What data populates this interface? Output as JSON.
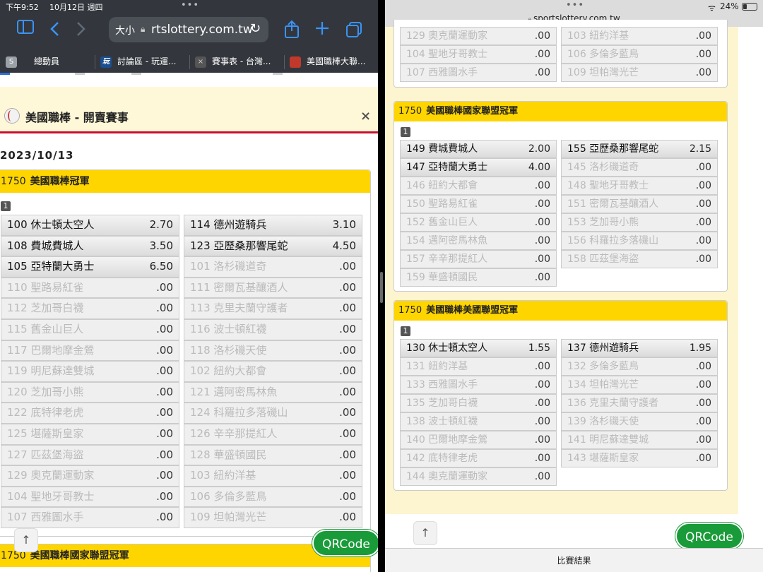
{
  "left_chrome": {
    "time": "下午9:52",
    "date": "10月12日 週四",
    "text_size": "大小",
    "url": "rtslottery.com.tw",
    "tabs": [
      {
        "label": "總動員",
        "icon": "S"
      },
      {
        "label": "討論區 - 玩運...",
        "icon": "玩"
      },
      {
        "label": "賽事表 - 台灣...",
        "icon": "×"
      },
      {
        "label": "美國職棒大聯...",
        "icon": ""
      }
    ]
  },
  "left_page": {
    "modal_title": "美國職棒 - 開賣賽事",
    "close": "×",
    "date": "2023/10/13",
    "game_id": "1750",
    "game_title": "美國職棒冠軍",
    "group_num": "1",
    "rows": [
      [
        {
          "t": "100 休士頓太空人",
          "o": "2.70",
          "on": true
        },
        {
          "t": "114 德州遊騎兵",
          "o": "3.10",
          "on": true
        }
      ],
      [
        {
          "t": "108 費城費城人",
          "o": "3.50",
          "on": true
        },
        {
          "t": "123 亞歷桑那響尾蛇",
          "o": "4.50",
          "on": true
        }
      ],
      [
        {
          "t": "105 亞特蘭大勇士",
          "o": "6.50",
          "on": true
        },
        {
          "t": "101 洛杉磯道奇",
          "o": ".00",
          "on": false
        }
      ],
      [
        {
          "t": "110 聖路易紅雀",
          "o": ".00",
          "on": false
        },
        {
          "t": "111 密爾瓦基釀酒人",
          "o": ".00",
          "on": false
        }
      ],
      [
        {
          "t": "112 芝加哥白襪",
          "o": ".00",
          "on": false
        },
        {
          "t": "113 克里夫蘭守護者",
          "o": ".00",
          "on": false
        }
      ],
      [
        {
          "t": "115 舊金山巨人",
          "o": ".00",
          "on": false
        },
        {
          "t": "116 波士頓紅襪",
          "o": ".00",
          "on": false
        }
      ],
      [
        {
          "t": "117 巴爾地摩金鶯",
          "o": ".00",
          "on": false
        },
        {
          "t": "118 洛杉磯天使",
          "o": ".00",
          "on": false
        }
      ],
      [
        {
          "t": "119 明尼蘇達雙城",
          "o": ".00",
          "on": false
        },
        {
          "t": "102 紐約大都會",
          "o": ".00",
          "on": false
        }
      ],
      [
        {
          "t": "120 芝加哥小熊",
          "o": ".00",
          "on": false
        },
        {
          "t": "121 邁阿密馬林魚",
          "o": ".00",
          "on": false
        }
      ],
      [
        {
          "t": "122 底特律老虎",
          "o": ".00",
          "on": false
        },
        {
          "t": "124 科羅拉多落磯山",
          "o": ".00",
          "on": false
        }
      ],
      [
        {
          "t": "125 堪薩斯皇家",
          "o": ".00",
          "on": false
        },
        {
          "t": "126 辛辛那提紅人",
          "o": ".00",
          "on": false
        }
      ],
      [
        {
          "t": "127 匹茲堡海盜",
          "o": ".00",
          "on": false
        },
        {
          "t": "128 華盛頓國民",
          "o": ".00",
          "on": false
        }
      ],
      [
        {
          "t": "129 奧克蘭運動家",
          "o": ".00",
          "on": false
        },
        {
          "t": "103 紐約洋基",
          "o": ".00",
          "on": false
        }
      ],
      [
        {
          "t": "104 聖地牙哥教士",
          "o": ".00",
          "on": false
        },
        {
          "t": "106 多倫多藍鳥",
          "o": ".00",
          "on": false
        }
      ],
      [
        {
          "t": "107 西雅圖水手",
          "o": ".00",
          "on": false
        },
        {
          "t": "109 坦帕灣光芒",
          "o": ".00",
          "on": false
        }
      ]
    ],
    "next_game_id": "1750",
    "next_game_title": "美國職棒國家聯盟冠軍",
    "back_top": "↑",
    "qr": "QRCode"
  },
  "right_chrome": {
    "url": "sportslottery.com.tw",
    "battery": "24%"
  },
  "right_page": {
    "top_rows": [
      [
        {
          "t": "129 奧克蘭運動家",
          "o": ".00",
          "on": false
        },
        {
          "t": "103 紐約洋基",
          "o": ".00",
          "on": false
        }
      ],
      [
        {
          "t": "104 聖地牙哥教士",
          "o": ".00",
          "on": false
        },
        {
          "t": "106 多倫多藍鳥",
          "o": ".00",
          "on": false
        }
      ],
      [
        {
          "t": "107 西雅圖水手",
          "o": ".00",
          "on": false
        },
        {
          "t": "109 坦帕灣光芒",
          "o": ".00",
          "on": false
        }
      ]
    ],
    "nl": {
      "id": "1750",
      "title": "美國職棒國家聯盟冠軍",
      "num": "1",
      "rows": [
        [
          {
            "t": "149 費城費城人",
            "o": "2.00",
            "on": true
          },
          {
            "t": "155 亞歷桑那響尾蛇",
            "o": "2.15",
            "on": true
          }
        ],
        [
          {
            "t": "147 亞特蘭大勇士",
            "o": "4.00",
            "on": true
          },
          {
            "t": "145 洛杉磯道奇",
            "o": ".00",
            "on": false
          }
        ],
        [
          {
            "t": "146 紐約大都會",
            "o": ".00",
            "on": false
          },
          {
            "t": "148 聖地牙哥教士",
            "o": ".00",
            "on": false
          }
        ],
        [
          {
            "t": "150 聖路易紅雀",
            "o": ".00",
            "on": false
          },
          {
            "t": "151 密爾瓦基釀酒人",
            "o": ".00",
            "on": false
          }
        ],
        [
          {
            "t": "152 舊金山巨人",
            "o": ".00",
            "on": false
          },
          {
            "t": "153 芝加哥小熊",
            "o": ".00",
            "on": false
          }
        ],
        [
          {
            "t": "154 邁阿密馬林魚",
            "o": ".00",
            "on": false
          },
          {
            "t": "156 科羅拉多落磯山",
            "o": ".00",
            "on": false
          }
        ],
        [
          {
            "t": "157 辛辛那提紅人",
            "o": ".00",
            "on": false
          },
          {
            "t": "158 匹茲堡海盜",
            "o": ".00",
            "on": false
          }
        ],
        [
          {
            "t": "159 華盛頓國民",
            "o": ".00",
            "on": false
          }
        ]
      ]
    },
    "al": {
      "id": "1750",
      "title": "美國職棒美國聯盟冠軍",
      "num": "1",
      "rows": [
        [
          {
            "t": "130 休士頓太空人",
            "o": "1.55",
            "on": true
          },
          {
            "t": "137 德州遊騎兵",
            "o": "1.95",
            "on": true
          }
        ],
        [
          {
            "t": "131 紐約洋基",
            "o": ".00",
            "on": false
          },
          {
            "t": "132 多倫多藍鳥",
            "o": ".00",
            "on": false
          }
        ],
        [
          {
            "t": "133 西雅圖水手",
            "o": ".00",
            "on": false
          },
          {
            "t": "134 坦帕灣光芒",
            "o": ".00",
            "on": false
          }
        ],
        [
          {
            "t": "135 芝加哥白襪",
            "o": ".00",
            "on": false
          },
          {
            "t": "136 克里夫蘭守護者",
            "o": ".00",
            "on": false
          }
        ],
        [
          {
            "t": "138 波士頓紅襪",
            "o": ".00",
            "on": false
          },
          {
            "t": "139 洛杉磯天使",
            "o": ".00",
            "on": false
          }
        ],
        [
          {
            "t": "140 巴爾地摩金鶯",
            "o": ".00",
            "on": false
          },
          {
            "t": "141 明尼蘇達雙城",
            "o": ".00",
            "on": false
          }
        ],
        [
          {
            "t": "142 底特律老虎",
            "o": ".00",
            "on": false
          },
          {
            "t": "143 堪薩斯皇家",
            "o": ".00",
            "on": false
          }
        ],
        [
          {
            "t": "144 奧克蘭運動家",
            "o": ".00",
            "on": false
          }
        ]
      ]
    },
    "back_top": "↑",
    "qr": "QRCode",
    "footer": "比賽結果"
  },
  "colors": {
    "header_yellow": "#ffd500",
    "page_bg": "#fdf5cf",
    "accent_red": "#c8102e",
    "qr_green": "#1a9b39",
    "ios_blue": "#3b93f6"
  }
}
